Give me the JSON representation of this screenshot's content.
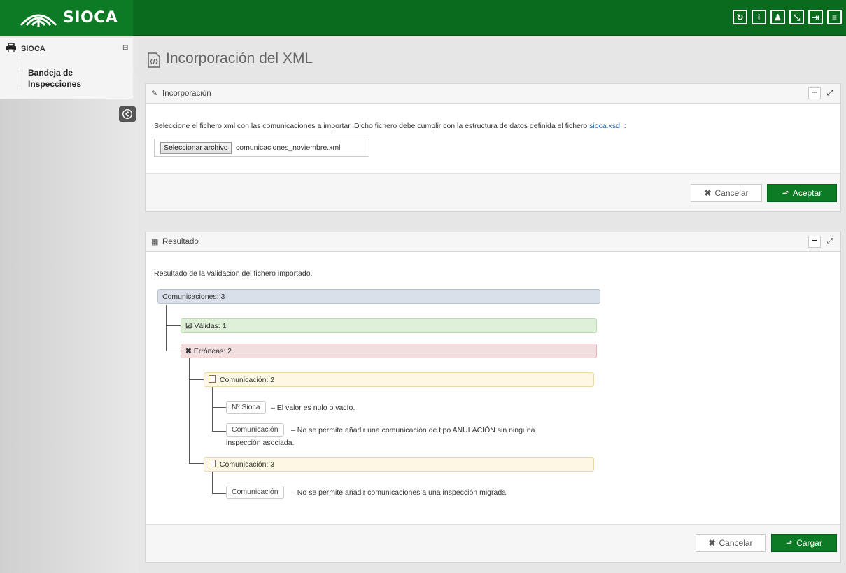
{
  "app": {
    "name": "SIOCA"
  },
  "topbar": {
    "buttons": [
      {
        "icon": "refresh-icon",
        "glyph": "↻"
      },
      {
        "icon": "info-icon",
        "glyph": "i"
      },
      {
        "icon": "user-icon",
        "glyph": "♟"
      },
      {
        "icon": "fullscreen-icon",
        "glyph": "⤡"
      },
      {
        "icon": "logout-icon",
        "glyph": "⇥"
      },
      {
        "icon": "menu-icon",
        "glyph": "≡"
      }
    ]
  },
  "sidebar": {
    "title": "SIOCA",
    "items": [
      {
        "label": "Bandeja de Inspecciones"
      }
    ]
  },
  "page": {
    "title": "Incorporación del XML"
  },
  "incorporacion": {
    "title": "Incorporación",
    "description_prefix": "Seleccione el fichero xml con las comunicaciones a importar. Dicho fichero debe cumplir con la estructura de datos definida el fichero ",
    "description_link": "sioca.xsd",
    "description_suffix": ". :",
    "file_button": "Seleccionar archivo",
    "file_name": "comunicaciones_noviembre.xml",
    "cancel_label": "Cancelar",
    "accept_label": "Aceptar"
  },
  "resultado": {
    "title": "Resultado",
    "description": "Resultado de la validación del fichero importado.",
    "tree": {
      "root": "Comunicaciones: 3",
      "valid": "Válidas: 1",
      "errors": "Erróneas: 2",
      "comm2": {
        "label": "Comunicación: 2",
        "errors": [
          {
            "field": "Nº Sioca",
            "message": "– El valor es nulo o vacío."
          },
          {
            "field": "Comunicación",
            "message": "– No se permite añadir una comunicación de tipo ANULACIÓN sin ninguna",
            "message2": "inspección asociada."
          }
        ]
      },
      "comm3": {
        "label": "Comunicación: 3",
        "errors": [
          {
            "field": "Comunicación",
            "message": "– No se permite añadir comunicaciones a una inspección migrada."
          }
        ]
      }
    },
    "cancel_label": "Cancelar",
    "load_label": "Cargar"
  }
}
